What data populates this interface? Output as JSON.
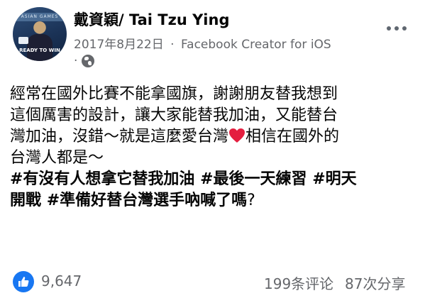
{
  "header": {
    "author_name": "戴資穎/ Tai Tzu Ying",
    "date": "2017年8月22日",
    "separator": "·",
    "source": "Facebook Creator for iOS",
    "privacy_separator": "·",
    "privacy_icon": "globe-icon",
    "more_icon": "more-horizontal-icon",
    "avatar_text": "READY TO WIN",
    "avatar_brand": "ASIAN GAMES"
  },
  "post": {
    "line1": "經常在國外比賽不能拿國旗，謝謝朋友替我想到",
    "line2": "這個厲害的設計，讓大家能替我加油，又能替台",
    "line3_before": "灣加油，沒錯～就是這麼愛台灣",
    "heart_icon": "red-heart-icon",
    "line3_after": "相信在國外的",
    "line4": "台灣人都是～",
    "hashtag1": "#有沒有人想拿它替我加油",
    "hashtag2": "#最後一天練習",
    "hashtag3_part1": "#明天",
    "hashtag3_part2": "開戰",
    "hashtag4": "#準備好替台灣選手吶喊了嗎",
    "trailing": "?"
  },
  "footer": {
    "like_icon": "like-thumb-icon",
    "like_count": "9,647",
    "comments": "199条评论",
    "shares": "87次分享"
  },
  "colors": {
    "text": "#050505",
    "secondary": "#65676b",
    "like_blue": "#1877f2",
    "heart_red": "#e41e3f"
  }
}
